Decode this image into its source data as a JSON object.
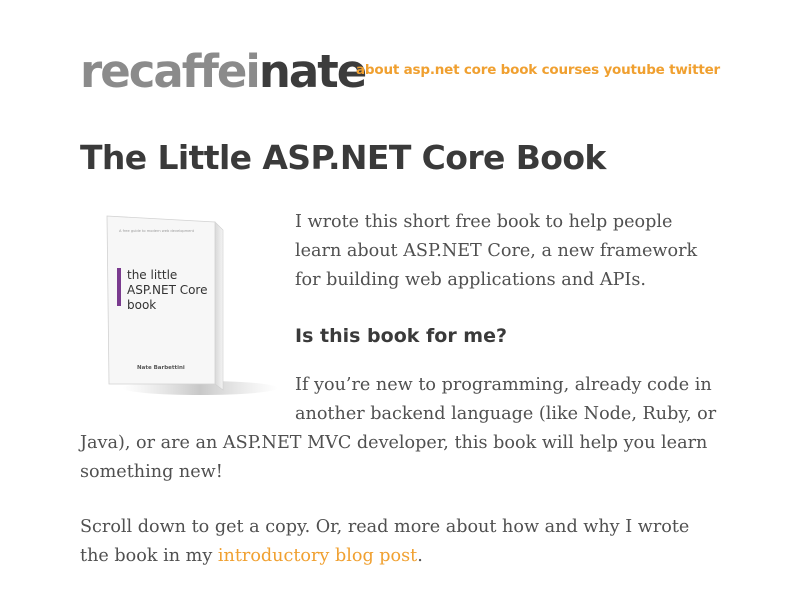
{
  "header": {
    "logo_light": "recaffei",
    "logo_dark": "nate",
    "nav": [
      {
        "label": "about"
      },
      {
        "label": "asp.net core book"
      },
      {
        "label": "courses"
      },
      {
        "label": "youtube"
      },
      {
        "label": "twitter"
      }
    ]
  },
  "page": {
    "title": "The Little ASP.NET Core Book",
    "intro": "I wrote this short free book to help people learn about ASP.NET Core, a new framework for building web applications and APIs.",
    "heading": "Is this book for me?",
    "para2": "If you’re new to programming, already code in another backend language (like Node, Ruby, or Java), or are an ASP.NET MVC developer, this book will help you learn something new!",
    "para3_prefix": "Scroll down to get a copy. Or, read more about how and why I wrote the book in my ",
    "para3_link": "introductory blog post",
    "para3_suffix": "."
  },
  "cover": {
    "tagline": "A free guide to modern web development",
    "title_line1": "the little",
    "title_line2": "ASP.NET Core",
    "title_line3": "book",
    "author": "Nate Barbettini",
    "accent_color": "#7a3b8f"
  },
  "colors": {
    "accent": "#f0a030",
    "logo_light": "#8b8b8b",
    "logo_dark": "#3c3c3c",
    "text": "#505050"
  }
}
